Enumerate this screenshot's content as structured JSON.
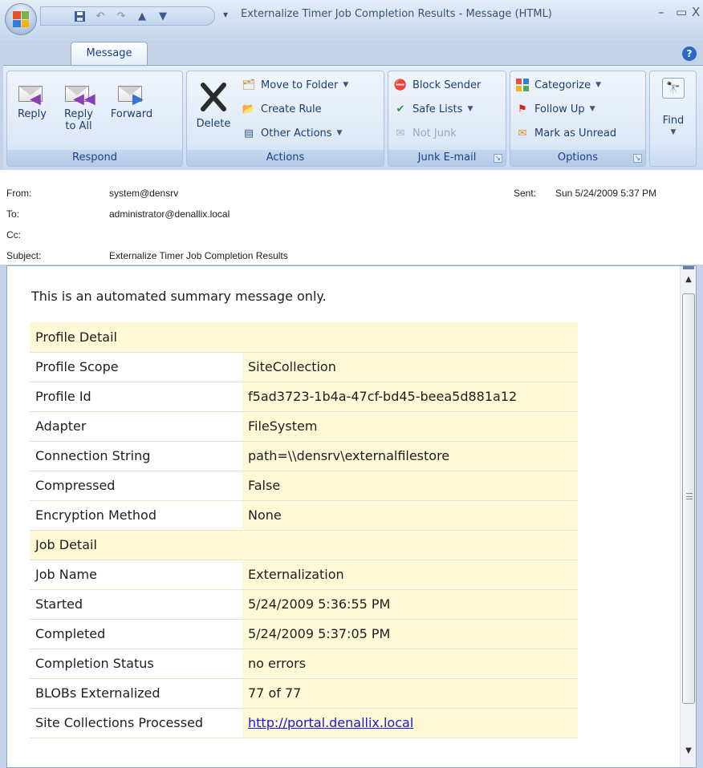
{
  "window": {
    "title": "Externalize Timer Job Completion Results - Message (HTML)",
    "minimize": "–",
    "maximize": "▭",
    "close": "X"
  },
  "tabs": [
    {
      "label": "Message"
    }
  ],
  "ribbon": {
    "respond": {
      "label": "Respond",
      "reply": "Reply",
      "reply_all_line1": "Reply",
      "reply_all_line2": "to All",
      "forward": "Forward"
    },
    "actions": {
      "label": "Actions",
      "delete": "Delete",
      "move_to_folder": "Move to Folder",
      "create_rule": "Create Rule",
      "other_actions": "Other Actions"
    },
    "junk": {
      "label": "Junk E-mail",
      "block_sender": "Block Sender",
      "safe_lists": "Safe Lists",
      "not_junk": "Not Junk"
    },
    "options": {
      "label": "Options",
      "categorize": "Categorize",
      "follow_up": "Follow Up",
      "mark_unread": "Mark as Unread"
    },
    "find": {
      "label": "Find"
    }
  },
  "header": {
    "from_label": "From:",
    "from": "system@densrv",
    "to_label": "To:",
    "to": "administrator@denallix.local",
    "cc_label": "Cc:",
    "cc": "",
    "subject_label": "Subject:",
    "subject": "Externalize Timer Job Completion Results",
    "sent_label": "Sent:",
    "sent": "Sun 5/24/2009 5:37 PM"
  },
  "message": {
    "intro": "This is an automated summary message only.",
    "profile_section": "Profile Detail",
    "profile_rows": [
      {
        "label": "Profile Scope",
        "value": "SiteCollection"
      },
      {
        "label": "Profile Id",
        "value": "f5ad3723-1b4a-47cf-bd45-beea5d881a12"
      },
      {
        "label": "Adapter",
        "value": "FileSystem"
      },
      {
        "label": "Connection String",
        "value": "path=\\\\densrv\\externalfilestore"
      },
      {
        "label": "Compressed",
        "value": "False"
      },
      {
        "label": "Encryption Method",
        "value": "None"
      }
    ],
    "job_section": "Job Detail",
    "job_rows": [
      {
        "label": "Job Name",
        "value": "Externalization"
      },
      {
        "label": "Started",
        "value": "5/24/2009 5:36:55 PM"
      },
      {
        "label": "Completed",
        "value": "5/24/2009 5:37:05 PM"
      },
      {
        "label": "Completion Status",
        "value": "no errors"
      },
      {
        "label": "BLOBs Externalized",
        "value": "77 of 77"
      }
    ],
    "site_collections_label": "Site Collections Processed",
    "site_collections_link": "http://portal.denallix.local"
  }
}
